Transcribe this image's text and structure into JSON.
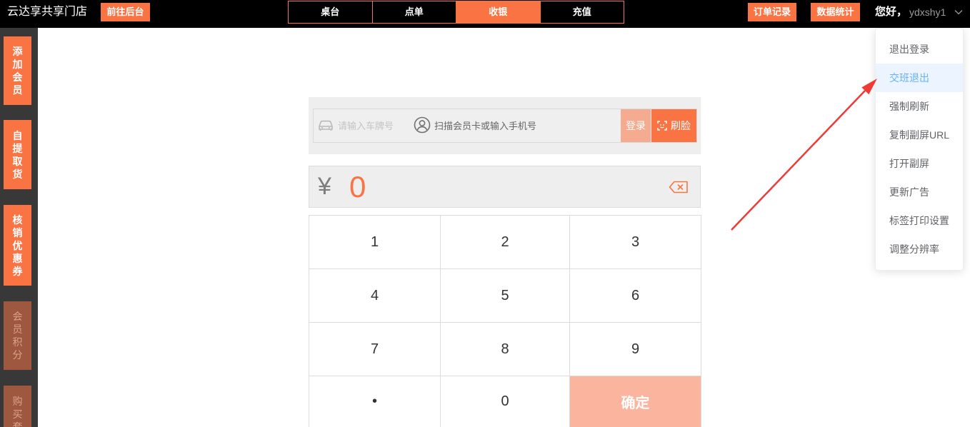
{
  "header": {
    "store_name": "云达享共享门店",
    "backend_button": "前往后台",
    "tabs": [
      {
        "label": "桌台",
        "active": false
      },
      {
        "label": "点单",
        "active": false
      },
      {
        "label": "收银",
        "active": true
      },
      {
        "label": "充值",
        "active": false
      }
    ],
    "order_records_button": "订单记录",
    "statistics_button": "数据统计",
    "greeting": "您好，",
    "username": "ydxshy1",
    "dropdown_icon": "chevron-down-icon"
  },
  "sidebar": {
    "items": [
      {
        "label": "添加会员",
        "dimmed": false
      },
      {
        "label": "自提取货",
        "dimmed": false
      },
      {
        "label": "核销优惠券",
        "dimmed": false
      },
      {
        "label": "会员积分",
        "dimmed": true
      },
      {
        "label": "购买套",
        "dimmed": true
      }
    ]
  },
  "member_login": {
    "plate_icon": "car-icon",
    "plate_placeholder": "请输入车牌号",
    "member_icon": "user-circle-icon",
    "member_placeholder": "扫描会员卡或输入手机号",
    "login_button": "登录",
    "face_icon": "face-scan-icon",
    "face_button": "刷脸"
  },
  "amount": {
    "currency_symbol": "¥",
    "value": "0",
    "clear_icon": "backspace-icon"
  },
  "keypad": {
    "keys": [
      "1",
      "2",
      "3",
      "4",
      "5",
      "6",
      "7",
      "8",
      "9",
      "•",
      "0"
    ],
    "confirm_label": "确定"
  },
  "user_menu": {
    "items": [
      {
        "label": "退出登录",
        "hovered": false
      },
      {
        "label": "交班退出",
        "hovered": true
      },
      {
        "label": "强制刷新",
        "hovered": false
      },
      {
        "label": "复制副屏URL",
        "hovered": false
      },
      {
        "label": "打开副屏",
        "hovered": false
      },
      {
        "label": "更新广告",
        "hovered": false
      },
      {
        "label": "标签打印设置",
        "hovered": false
      },
      {
        "label": "调整分辨率",
        "hovered": false
      }
    ]
  },
  "colors": {
    "accent": "#fa7343",
    "accent_light": "#f4ab8f",
    "confirm": "#fbb49e",
    "sidebar_dimmed_bg": "#9f5840",
    "sidebar_dimmed_text": "#dba18b",
    "sidebar_bg": "#383838",
    "panel_bg": "#eeeeee",
    "menu_hover_bg": "#ecf5ff",
    "menu_hover_text": "#66b1ff",
    "annotation": "#ef3a36"
  }
}
